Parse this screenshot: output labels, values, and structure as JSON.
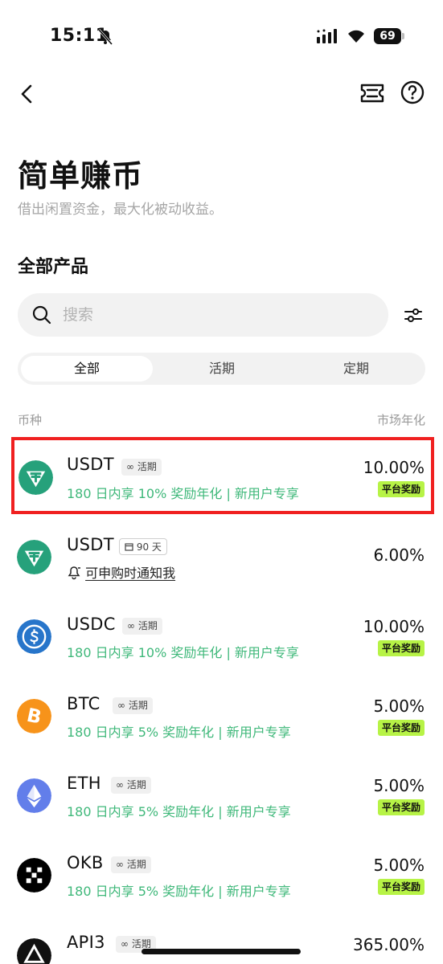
{
  "status_bar": {
    "time": "15:11",
    "battery": "69"
  },
  "header": {
    "title": "简单赚币",
    "subtitle": "借出闲置资金，最大化被动收益。"
  },
  "section": {
    "title": "全部产品"
  },
  "search": {
    "placeholder": "搜索"
  },
  "tabs": [
    {
      "label": "全部",
      "active": true
    },
    {
      "label": "活期",
      "active": false
    },
    {
      "label": "定期",
      "active": false
    }
  ],
  "columns": {
    "left": "币种",
    "right": "市场年化"
  },
  "products": [
    {
      "coin": "USDT",
      "term": "活期",
      "sub": "180 日内享 10% 奖励年化 | 新用户专享",
      "apr": "10.00%",
      "badge": "平台奖励",
      "icon": "tether-icon",
      "color": "#26a17b",
      "highlighted": true
    },
    {
      "coin": "USDT",
      "term": "90 天",
      "sub": "可申购时通知我",
      "apr": "6.00%",
      "badge": "",
      "icon": "tether-icon",
      "color": "#26a17b",
      "highlighted": false
    },
    {
      "coin": "USDC",
      "term": "活期",
      "sub": "180 日内享 10% 奖励年化 | 新用户专享",
      "apr": "10.00%",
      "badge": "平台奖励",
      "icon": "usdc-icon",
      "color": "#2775ca",
      "highlighted": false
    },
    {
      "coin": "BTC",
      "term": "活期",
      "sub": "180 日内享 5% 奖励年化 | 新用户专享",
      "apr": "5.00%",
      "badge": "平台奖励",
      "icon": "bitcoin-icon",
      "color": "#f7931a",
      "highlighted": false
    },
    {
      "coin": "ETH",
      "term": "活期",
      "sub": "180 日内享 5% 奖励年化 | 新用户专享",
      "apr": "5.00%",
      "badge": "平台奖励",
      "icon": "ethereum-icon",
      "color": "#627eea",
      "highlighted": false
    },
    {
      "coin": "OKB",
      "term": "活期",
      "sub": "180 日内享 5% 奖励年化 | 新用户专享",
      "apr": "5.00%",
      "badge": "平台奖励",
      "icon": "okb-icon",
      "color": "#000000",
      "highlighted": false
    },
    {
      "coin": "API3",
      "term": "活期",
      "sub": "",
      "apr": "365.00%",
      "badge": "",
      "icon": "api3-icon",
      "color": "#111111",
      "highlighted": false
    }
  ]
}
